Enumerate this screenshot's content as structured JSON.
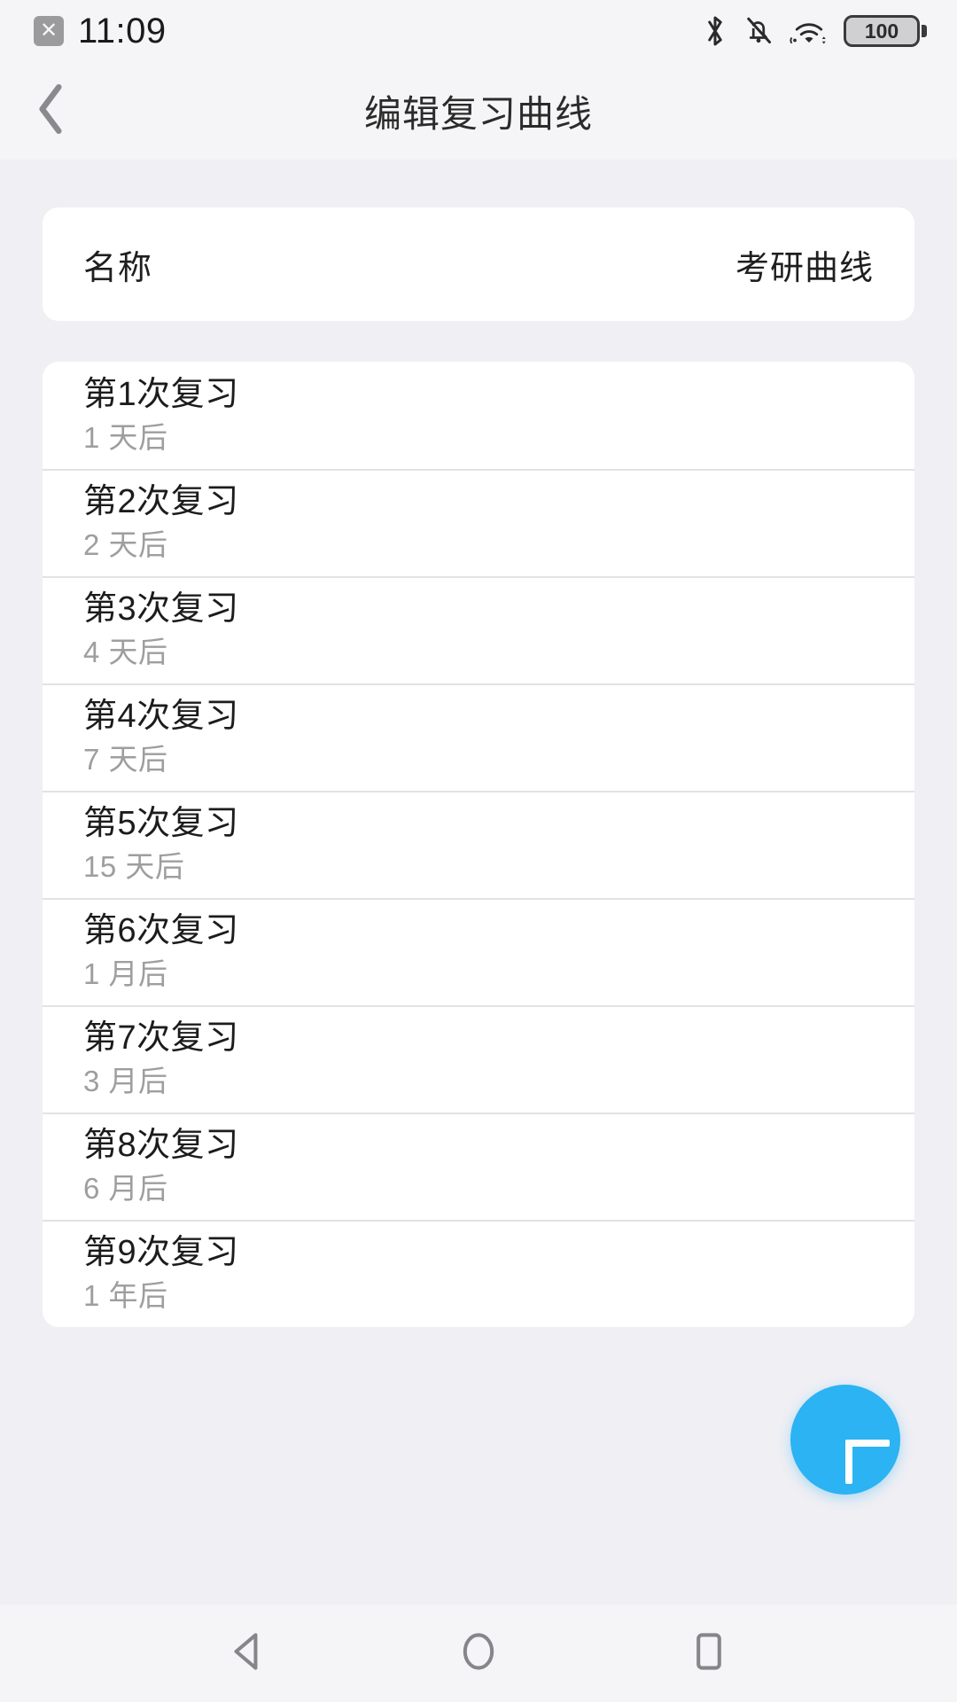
{
  "status_bar": {
    "close_badge_icon": "close-badge-icon",
    "close_badge_glyph": "✕",
    "time": "11:09",
    "icons": [
      "bluetooth-icon",
      "bell-muted-icon",
      "wifi-icon",
      "battery-icon"
    ],
    "battery_level": "100"
  },
  "app_bar": {
    "back_icon": "back-chevron-icon",
    "title": "编辑复习曲线"
  },
  "name_card": {
    "label": "名称",
    "value": "考研曲线"
  },
  "review_list": [
    {
      "title": "第1次复习",
      "interval": "1 天后"
    },
    {
      "title": "第2次复习",
      "interval": "2 天后"
    },
    {
      "title": "第3次复习",
      "interval": "4 天后"
    },
    {
      "title": "第4次复习",
      "interval": "7 天后"
    },
    {
      "title": "第5次复习",
      "interval": "15 天后"
    },
    {
      "title": "第6次复习",
      "interval": "1 月后"
    },
    {
      "title": "第7次复习",
      "interval": "3 月后"
    },
    {
      "title": "第8次复习",
      "interval": "6 月后"
    },
    {
      "title": "第9次复习",
      "interval": "1 年后"
    }
  ],
  "fab": {
    "icon": "plus-icon",
    "color": "#2BB3F3"
  },
  "nav_bar": {
    "back_icon": "nav-back-triangle-icon",
    "home_icon": "nav-home-circle-icon",
    "recents_icon": "nav-recents-square-icon"
  },
  "colors": {
    "accent": "#2BB3F3",
    "page_background": "#EFEFF4",
    "bar_background": "#F5F5F7",
    "card_background": "#FFFFFF",
    "primary_text": "#1C1C1C",
    "secondary_text": "#9E9E9E",
    "divider": "#E2E2E4"
  }
}
